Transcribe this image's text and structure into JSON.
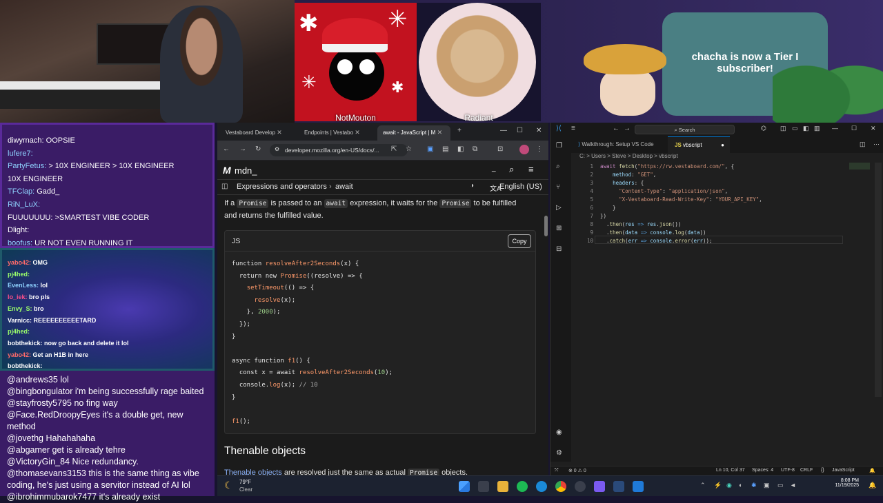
{
  "stream": {
    "card1_label": "NotMouton",
    "card2_label": "Radiant",
    "alert_text": "chacha is now a Tier I subscriber!"
  },
  "chat_top": [
    {
      "user": "diwyrnach:",
      "msg": "OOPSIE",
      "color": "#ffffff"
    },
    {
      "user": "lufere7:",
      "msg": "",
      "color": "#8fd3ff"
    },
    {
      "user": "PartyFetus:",
      "msg": "> 10X ENGINEER > 10X ENGINEER",
      "color": "#8fd3ff"
    },
    {
      "user": "",
      "msg": "10X ENGINEER",
      "color": "#ffffff"
    },
    {
      "user": "TFClap:",
      "msg": "Gadd_",
      "color": "#8fd3ff"
    },
    {
      "user": "RiN_LuX:",
      "msg": "",
      "color": "#8fd3ff"
    },
    {
      "user": "FUUUUUUU:",
      "msg": ">SMARTEST VIBE CODER",
      "color": "#ffffff"
    },
    {
      "user": "Dlight:",
      "msg": "",
      "color": "#ffffff"
    },
    {
      "user": "boofus:",
      "msg": "UR NOT EVEN RUNNING IT",
      "color": "#8fd3ff"
    }
  ],
  "chat_mid": [
    {
      "user": "yabo42:",
      "msg": "OMG",
      "color": "#ff6a6a"
    },
    {
      "user": "pj4hed:",
      "msg": "",
      "color": "#9bff6a"
    },
    {
      "user": "EvenLess:",
      "msg": "lol",
      "color": "#8fd3ff"
    },
    {
      "user": "lo_iek:",
      "msg": "bro pls",
      "color": "#ff4f8a"
    },
    {
      "user": "Envy_S:",
      "msg": "bro",
      "color": "#9bff6a"
    },
    {
      "user": "Varnicc:",
      "msg": "REEEEEEEEEETARD",
      "color": "#ffffff"
    },
    {
      "user": "pj4hed:",
      "msg": "",
      "color": "#9bff6a"
    },
    {
      "user": "bobthekick:",
      "msg": "now go back and delete it lol",
      "color": "#ffffff"
    },
    {
      "user": "yabo42:",
      "msg": "Get an H1B in here",
      "color": "#ff6a6a"
    },
    {
      "user": "bobthekick:",
      "msg": "",
      "color": "#ffffff"
    }
  ],
  "chat_bottom": [
    {
      "user": "@andrews35",
      "msg": "lol"
    },
    {
      "user": "@bingbongulator",
      "msg": "i'm being successfully rage baited"
    },
    {
      "user": "@stayfrosty5795",
      "msg": "no fing way"
    },
    {
      "user": "@Face.RedDroopyEyes",
      "msg": "it's a double get, new method"
    },
    {
      "user": "@jovethg",
      "msg": "Hahahahaha"
    },
    {
      "user": "@abgamer",
      "msg": "get is already tehre"
    },
    {
      "user": "@VictoryGin_84",
      "msg": "Nice redundancy."
    },
    {
      "user": "@thomasevans3153",
      "msg": "this is the same thing as vibe coding, he's just using a servitor instead of AI lol"
    },
    {
      "user": "@ibrohimmubarok7477",
      "msg": "it's already exist"
    }
  ],
  "browser": {
    "tabs": [
      "Vestaboard Develop",
      "Endpoints | Vestabo",
      "await - JavaScript | M"
    ],
    "url": "developer.mozilla.org/en-US/docs/...",
    "logo": "mdn_",
    "breadcrumb": [
      "Expressions and operators",
      "await"
    ],
    "language": "English (US)",
    "para_prefix": "If a",
    "para_code1": "Promise",
    "para_mid1": "is passed to an",
    "para_code2": "await",
    "para_mid2": "expression, it waits for the",
    "para_code3": "Promise",
    "para_end": "to be fulfilled and returns the fulfilled value.",
    "code_lang": "JS",
    "copy_label": "Copy",
    "section_title": "Thenable objects",
    "p2_link": "Thenable objects",
    "p2_mid": "are resolved just the same as actual",
    "p2_code": "Promise",
    "p2_end": "objects."
  },
  "vscode": {
    "search": "Search",
    "tab1": "Walkthrough: Setup VS Code",
    "tab2": "vbscript",
    "breadcrumb": "C: > Users > Steve > Desktop > vbscript",
    "status_left": "⊗ 0 ⚠ 0",
    "status_pos": "Ln 10, Col 37",
    "status_spaces": "Spaces: 4",
    "status_enc": "UTF-8",
    "status_eol": "CRLF",
    "status_lang": "JavaScript"
  },
  "taskbar": {
    "weather_temp": "79°F",
    "weather_desc": "Clear",
    "time": "8:08 PM",
    "date": "11/19/2025"
  }
}
